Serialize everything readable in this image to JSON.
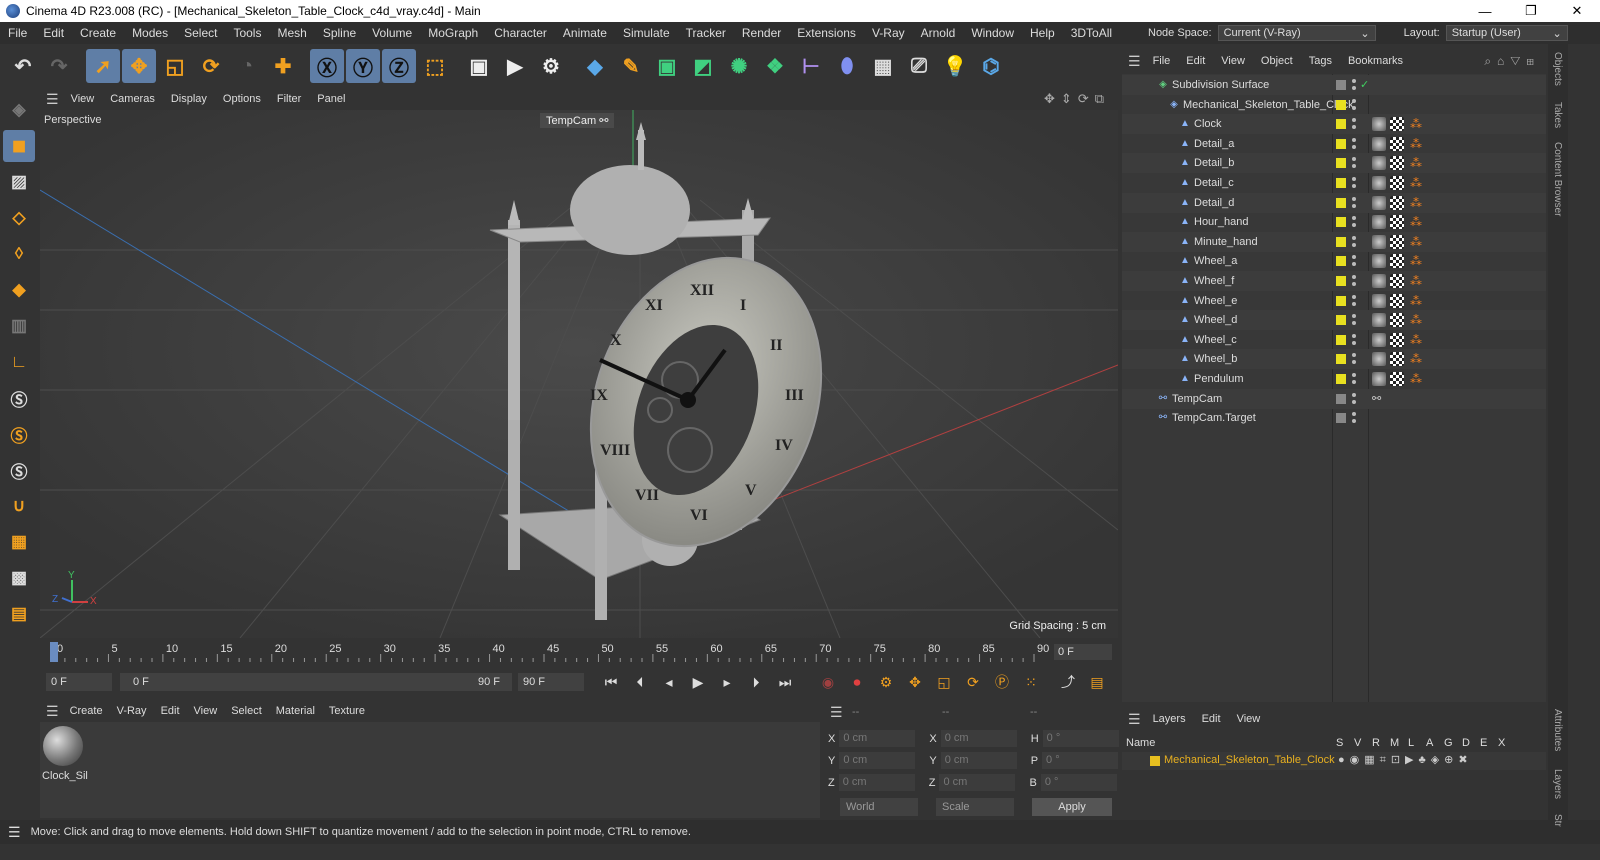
{
  "window": {
    "title": "Cinema 4D R23.008 (RC) - [Mechanical_Skeleton_Table_Clock_c4d_vray.c4d] - Main",
    "minimize": "—",
    "maximize": "❐",
    "close": "✕"
  },
  "menu": [
    "File",
    "Edit",
    "Create",
    "Modes",
    "Select",
    "Tools",
    "Mesh",
    "Spline",
    "Volume",
    "MoGraph",
    "Character",
    "Animate",
    "Simulate",
    "Tracker",
    "Render",
    "Extensions",
    "V-Ray",
    "Arnold",
    "Window",
    "Help",
    "3DToAll"
  ],
  "node_space": {
    "label": "Node Space:",
    "value": "Current (V-Ray)"
  },
  "layout": {
    "label": "Layout:",
    "value": "Startup (User)"
  },
  "viewport": {
    "menu": [
      "View",
      "Cameras",
      "Display",
      "Options",
      "Filter",
      "Panel"
    ],
    "label": "Perspective",
    "camera": "TempCam",
    "grid_spacing": "Grid Spacing : 5 cm",
    "axis_labels": {
      "y": "Y",
      "z": "Z",
      "x": "X"
    }
  },
  "timeline": {
    "ticks": [
      "0",
      "5",
      "10",
      "15",
      "20",
      "25",
      "30",
      "35",
      "40",
      "45",
      "50",
      "55",
      "60",
      "65",
      "70",
      "75",
      "80",
      "85",
      "90"
    ],
    "current_frame": "0 F"
  },
  "transport": {
    "start": "0 F",
    "range_start": "0 F",
    "range_end": "90 F",
    "end": "90 F"
  },
  "material_menu": [
    "Create",
    "V-Ray",
    "Edit",
    "View",
    "Select",
    "Material",
    "Texture"
  ],
  "material": {
    "name": "Clock_Sil"
  },
  "coords": {
    "headers": [
      "--",
      "--",
      "--"
    ],
    "rows": [
      {
        "a": "X",
        "av": "0 cm",
        "b": "X",
        "bv": "0 cm",
        "c": "H",
        "cv": "0 °"
      },
      {
        "a": "Y",
        "av": "0 cm",
        "b": "Y",
        "bv": "0 cm",
        "c": "P",
        "cv": "0 °"
      },
      {
        "a": "Z",
        "av": "0 cm",
        "b": "Z",
        "bv": "0 cm",
        "c": "B",
        "cv": "0 °"
      }
    ],
    "mode": "World",
    "scale": "Scale",
    "apply": "Apply"
  },
  "status": "Move: Click and drag to move elements. Hold down SHIFT to quantize movement / add to the selection in point mode, CTRL to remove.",
  "objects_menu": [
    "File",
    "Edit",
    "View",
    "Object",
    "Tags",
    "Bookmarks"
  ],
  "objects": [
    {
      "name": "Subdivision Surface",
      "level": 0,
      "color": "#888888",
      "check": "✓"
    },
    {
      "name": "Mechanical_Skeleton_Table_Clock",
      "level": 1,
      "color": "#e8e020"
    },
    {
      "name": "Clock",
      "level": 2,
      "color": "#e8e020"
    },
    {
      "name": "Detail_a",
      "level": 2,
      "color": "#e8e020"
    },
    {
      "name": "Detail_b",
      "level": 2,
      "color": "#e8e020"
    },
    {
      "name": "Detail_c",
      "level": 2,
      "color": "#e8e020"
    },
    {
      "name": "Detail_d",
      "level": 2,
      "color": "#e8e020"
    },
    {
      "name": "Hour_hand",
      "level": 2,
      "color": "#e8e020"
    },
    {
      "name": "Minute_hand",
      "level": 2,
      "color": "#e8e020"
    },
    {
      "name": "Wheel_a",
      "level": 2,
      "color": "#e8e020"
    },
    {
      "name": "Wheel_f",
      "level": 2,
      "color": "#e8e020"
    },
    {
      "name": "Wheel_e",
      "level": 2,
      "color": "#e8e020"
    },
    {
      "name": "Wheel_d",
      "level": 2,
      "color": "#e8e020"
    },
    {
      "name": "Wheel_c",
      "level": 2,
      "color": "#e8e020"
    },
    {
      "name": "Wheel_b",
      "level": 2,
      "color": "#e8e020"
    },
    {
      "name": "Pendulum",
      "level": 2,
      "color": "#e8e020"
    },
    {
      "name": "TempCam",
      "level": 0,
      "color": "#888888"
    },
    {
      "name": "TempCam.Target",
      "level": 0,
      "color": "#888888"
    }
  ],
  "layers_menu": [
    "Layers",
    "Edit",
    "View"
  ],
  "layers_header": {
    "name": "Name",
    "flags": [
      "S",
      "V",
      "R",
      "M",
      "L",
      "A",
      "G",
      "D",
      "E",
      "X"
    ]
  },
  "layer": {
    "name": "Mechanical_Skeleton_Table_Clock",
    "color": "#e8c020"
  },
  "right_tabs": [
    "Objects",
    "Takes",
    "Content Browser",
    "Attributes",
    "Layers",
    "Str"
  ]
}
